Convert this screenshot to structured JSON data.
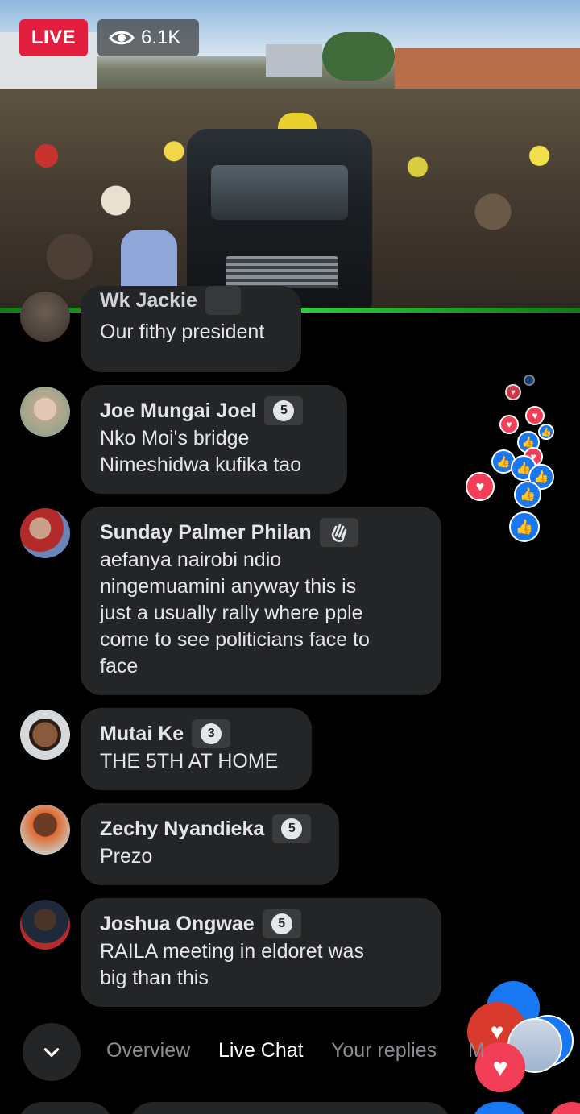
{
  "stream": {
    "live_label": "LIVE",
    "viewer_count": "6.1K"
  },
  "comments": [
    {
      "name": "Wk Jackie",
      "text": "Our fithy president"
    },
    {
      "name": "Joe Mungai Joel",
      "badge": "5",
      "text_lines": [
        "Nko Moi's bridge",
        "Nimeshidwa kufika tao"
      ]
    },
    {
      "name": "Sunday Palmer Philan",
      "badge": "wave",
      "text_lines": [
        "aefanya nairobi ndio",
        "ningemuamini anyway this is",
        "just a usually rally where pple",
        "come to see politicians face to",
        "face"
      ]
    },
    {
      "name": "Mutai Ke",
      "badge": "3",
      "text_lines": [
        "THE 5TH AT HOME"
      ]
    },
    {
      "name": "Zechy Nyandieka",
      "badge": "5",
      "text_lines": [
        "Prezo"
      ]
    },
    {
      "name": "Joshua Ongwae",
      "badge": "5",
      "text_lines": [
        "RAILA meeting in eldoret was",
        "big than this"
      ]
    }
  ],
  "tabs": {
    "overview": "Overview",
    "live_chat": "Live Chat",
    "your_replies": "Your replies",
    "more_partial": "M"
  },
  "colors": {
    "live_red": "#e41e3f",
    "bubble": "#242526",
    "like_blue": "#1877f2",
    "heart_red": "#f33e58"
  },
  "icons": [
    "eye-icon",
    "wave-icon",
    "like-icon",
    "heart-icon",
    "chevron-down-icon"
  ]
}
